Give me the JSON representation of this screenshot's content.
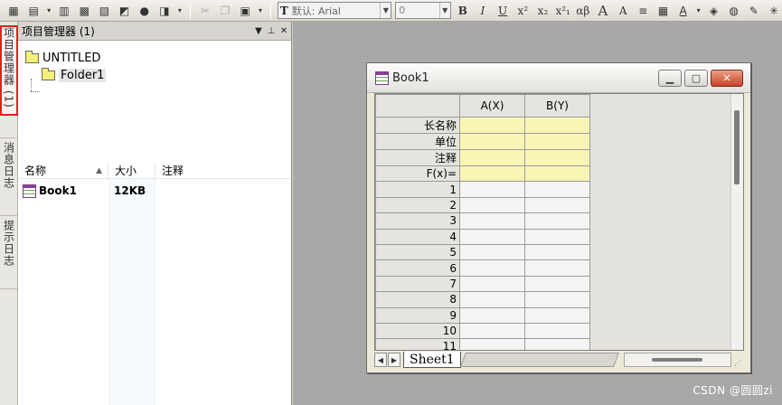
{
  "toolbar": {
    "font_name": "默认: Arial",
    "font_size": "0",
    "format_buttons": [
      "B",
      "I",
      "U",
      "x²",
      "x₂",
      "x²₁",
      "αβ",
      "A",
      "A"
    ]
  },
  "left_tabs": [
    {
      "label": "项目管理器 (1)",
      "active": true
    },
    {
      "label": "消息日志",
      "active": false
    },
    {
      "label": "提示日志",
      "active": false
    }
  ],
  "project_manager": {
    "title": "项目管理器 (1)",
    "tree": {
      "root": "UNTITLED",
      "child": "Folder1"
    },
    "list": {
      "headers": [
        "名称",
        "大小",
        "注释"
      ],
      "rows": [
        {
          "name": "Book1",
          "size": "12KB",
          "note": ""
        }
      ]
    }
  },
  "book_window": {
    "title": "Book1",
    "columns": [
      "A(X)",
      "B(Y)"
    ],
    "label_rows": [
      "长名称",
      "单位",
      "注释",
      "F(x)="
    ],
    "data_rows": [
      "1",
      "2",
      "3",
      "4",
      "5",
      "6",
      "7",
      "8",
      "9",
      "10",
      "11"
    ],
    "sheet_tab": "Sheet1"
  },
  "watermark": "CSDN @圆圆zi",
  "colors": {
    "active_tab_border": "#e02020",
    "label_cell": "#f8f5b5",
    "workspace": "#a8a8a8",
    "close_button": "#c8442a"
  }
}
